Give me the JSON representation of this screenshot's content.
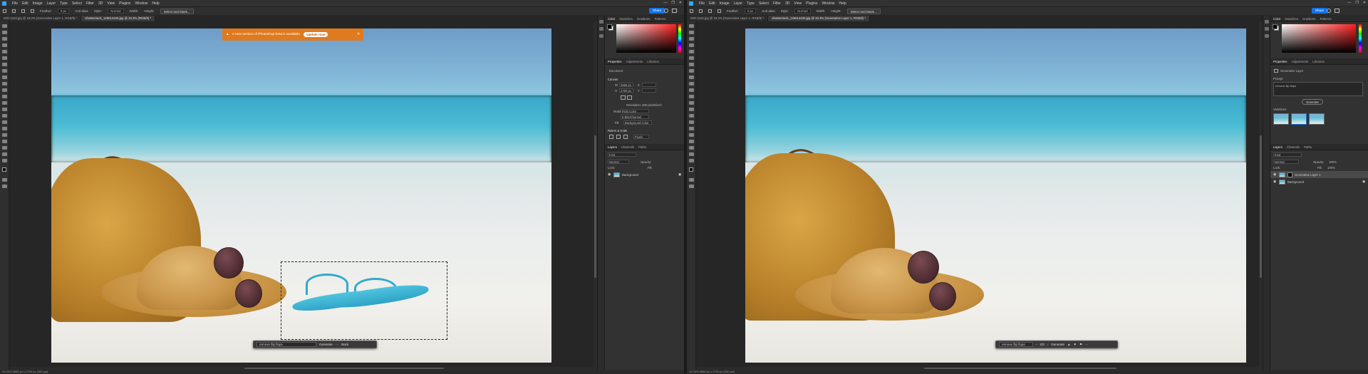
{
  "menu": [
    "File",
    "Edit",
    "Image",
    "Layer",
    "Type",
    "Select",
    "Filter",
    "3D",
    "View",
    "Plugins",
    "Window",
    "Help"
  ],
  "window_controls": [
    "—",
    "❐",
    "✕"
  ],
  "options": {
    "feather_label": "Feather:",
    "feather_value": "0 px",
    "antialias": "Anti-alias",
    "style_label": "Style:",
    "style_value": "Normal",
    "width_label": "Width:",
    "height_label": "Height:",
    "select_mask": "Select and Mask..."
  },
  "share_label": "Share",
  "left": {
    "tabs": [
      {
        "label": "IMG-1104.jpg @ 33.3% (Generative Layer 1, RGB/8) *"
      },
      {
        "label": "shutterstock_125014425.jpg @ 33.3% (RGB/8) *"
      }
    ],
    "banner": {
      "text": "A new version of Photoshop beta is available.",
      "button": "Update now"
    },
    "context_bar": {
      "prompt": "remove flip flops",
      "generate": "Generate",
      "more": "···",
      "back": "Back"
    },
    "status": "33.33%   3656 px x 2790 px (300 ppi)",
    "panel_tabs_top": [
      "Color",
      "Swatches",
      "Gradients",
      "Patterns"
    ],
    "panel_tabs_props": [
      "Properties",
      "Adjustments",
      "Libraries"
    ],
    "props": {
      "doc_label": "Document",
      "canvas_label": "Canvas",
      "w_label": "W",
      "w_value": "3656 px",
      "h_label": "H",
      "h_value": "2790 px",
      "x_label": "X",
      "y_label": "Y",
      "resolution": "Resolution: 300 pixels/inch",
      "mode_label": "Mode",
      "mode_value": "RGB Color",
      "depth_value": "8 Bits/Channel",
      "fill_label": "Fill",
      "fill_value": "Background Color",
      "rulers_label": "Rulers & Grids",
      "units_value": "Pixels"
    },
    "layers_tabs": [
      "Layers",
      "Channels",
      "Paths"
    ],
    "layers": {
      "kind": "Kind",
      "mode": "Normal",
      "opacity": "Opacity:",
      "lock": "Lock:",
      "fill": "Fill:",
      "items": [
        {
          "name": "Background"
        }
      ]
    }
  },
  "right": {
    "tabs": [
      {
        "label": "IMG-1104.jpg @ 33.3% (Generative Layer 1, RGB/8) *"
      },
      {
        "label": "shutterstock_125014425.jpg @ 33.3% (Generative Layer 1, RGB/8) *"
      }
    ],
    "context_bar": {
      "prompt": "remove flip flops",
      "counter": "2/3",
      "generate": "Generate"
    },
    "status": "33.33%   3656 px x 2790 px (300 ppi)",
    "panel_tabs_top": [
      "Color",
      "Swatches",
      "Gradients",
      "Patterns"
    ],
    "panel_tabs_props": [
      "Properties",
      "Adjustments",
      "Libraries"
    ],
    "props": {
      "layer_type": "Generative Layer",
      "prompt_label": "Prompt",
      "prompt_value": "remove flip flops",
      "generate": "Generate",
      "variations_label": "Variations"
    },
    "layers_tabs": [
      "Layers",
      "Channels",
      "Paths"
    ],
    "layers": {
      "kind": "Kind",
      "mode": "Normal",
      "opacity": "Opacity:",
      "opacity_value": "100%",
      "lock": "Lock:",
      "fill": "Fill:",
      "fill_value": "100%",
      "items": [
        {
          "name": "Generative Layer 1"
        },
        {
          "name": "Background"
        }
      ]
    }
  },
  "colors": {
    "accent": "#1473e6",
    "banner": "#e07a1f",
    "panel": "#323232",
    "chrome": "#282828"
  }
}
